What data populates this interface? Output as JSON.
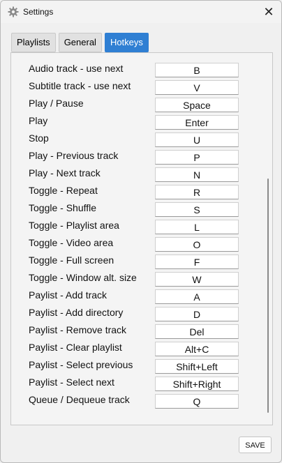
{
  "window": {
    "title": "Settings",
    "icon": "gear-icon",
    "close_glyph": "✕"
  },
  "tabs": [
    {
      "label": "Playlists",
      "active": false
    },
    {
      "label": "General",
      "active": false
    },
    {
      "label": "Hotkeys",
      "active": true
    }
  ],
  "hotkeys": [
    {
      "action": "Audio track - use next",
      "key": "B"
    },
    {
      "action": "Subtitle track - use next",
      "key": "V"
    },
    {
      "action": "Play / Pause",
      "key": "Space"
    },
    {
      "action": "Play",
      "key": "Enter"
    },
    {
      "action": "Stop",
      "key": "U"
    },
    {
      "action": "Play - Previous track",
      "key": "P"
    },
    {
      "action": "Play - Next track",
      "key": "N"
    },
    {
      "action": "Toggle - Repeat",
      "key": "R"
    },
    {
      "action": "Toggle - Shuffle",
      "key": "S"
    },
    {
      "action": "Toggle - Playlist area",
      "key": "L"
    },
    {
      "action": "Toggle - Video area",
      "key": "O"
    },
    {
      "action": "Toggle - Full screen",
      "key": "F"
    },
    {
      "action": "Toggle - Window alt. size",
      "key": "W"
    },
    {
      "action": "Paylist - Add track",
      "key": "A"
    },
    {
      "action": "Paylist - Add directory",
      "key": "D"
    },
    {
      "action": "Paylist - Remove track",
      "key": "Del"
    },
    {
      "action": "Paylist - Clear playlist",
      "key": "Alt+C"
    },
    {
      "action": "Paylist - Select previous",
      "key": "Shift+Left"
    },
    {
      "action": "Paylist - Select next",
      "key": "Shift+Right"
    },
    {
      "action": "Queue / Dequeue track",
      "key": "Q"
    }
  ],
  "footer": {
    "save_label": "SAVE"
  },
  "colors": {
    "accent": "#2f7fd3",
    "background": "#f0f0f0"
  }
}
